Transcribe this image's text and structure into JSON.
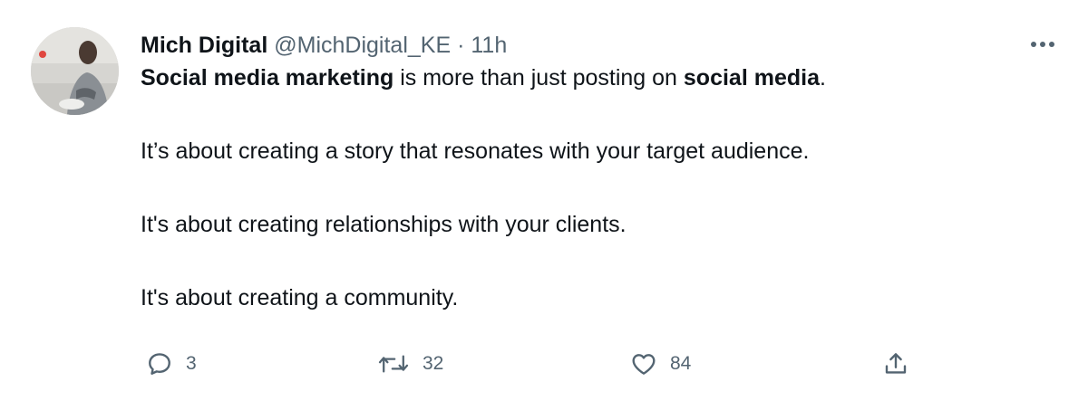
{
  "tweet": {
    "author": {
      "name": "Mich Digital",
      "handle": "@MichDigital_KE"
    },
    "separator": "·",
    "timestamp": "11h",
    "paragraphs": [
      {
        "bold_1": "Social media marketing",
        "text_1": " is more than just posting on ",
        "bold_2": "social media",
        "text_2": "."
      },
      {
        "text": "It’s about creating a story that resonates with your target audience."
      },
      {
        "text": "It's about creating relationships with your clients."
      },
      {
        "text": "It's about creating a community."
      }
    ],
    "actions": {
      "replies": "3",
      "retweets": "32",
      "likes": "84"
    }
  },
  "icons": {
    "more": "more-horizontal-icon",
    "reply": "speech-bubble-icon",
    "retweet": "retweet-arrows-icon",
    "like": "heart-icon",
    "share": "share-upload-icon"
  },
  "colors": {
    "text_primary": "#0f1419",
    "text_secondary": "#536471",
    "background": "#ffffff"
  }
}
